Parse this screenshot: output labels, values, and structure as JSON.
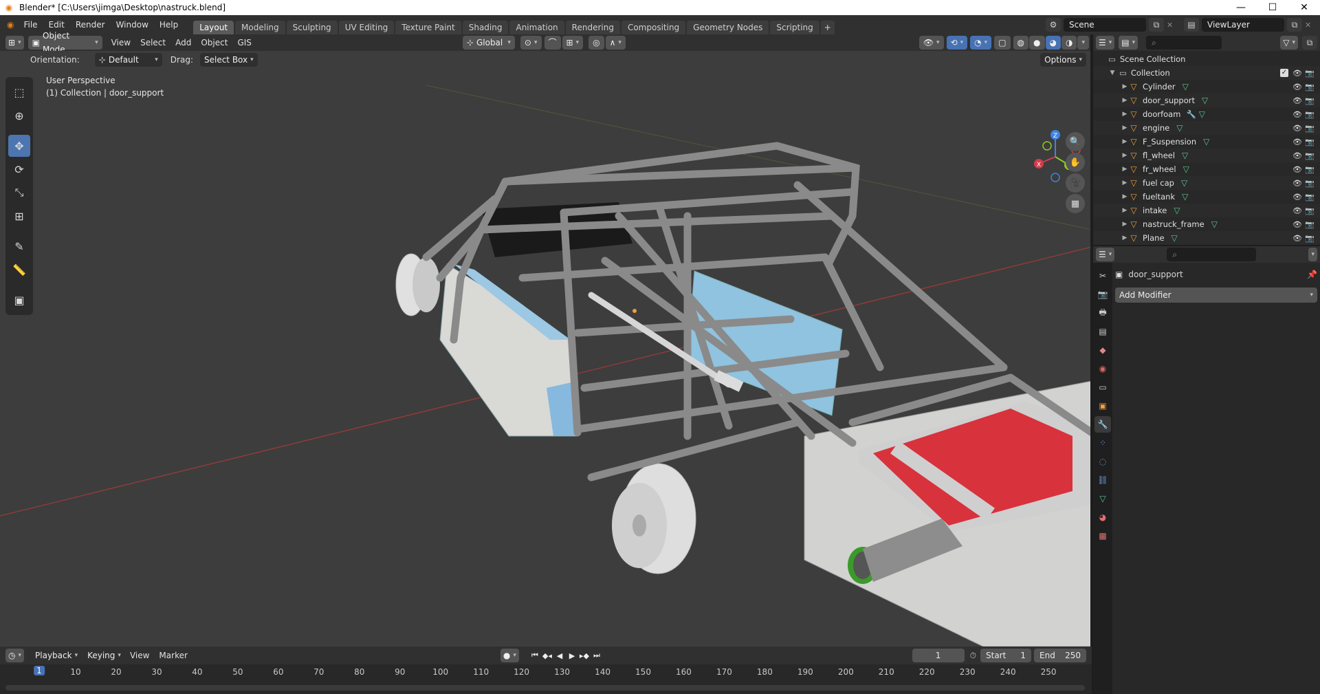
{
  "titlebar": {
    "title": "Blender* [C:\\Users\\jimga\\Desktop\\nastruck.blend]",
    "minimize": "—",
    "maximize": "☐",
    "close": "✕"
  },
  "menu": {
    "items": [
      "File",
      "Edit",
      "Render",
      "Window",
      "Help"
    ]
  },
  "workspaces": {
    "tabs": [
      "Layout",
      "Modeling",
      "Sculpting",
      "UV Editing",
      "Texture Paint",
      "Shading",
      "Animation",
      "Rendering",
      "Compositing",
      "Geometry Nodes",
      "Scripting"
    ],
    "active": "Layout",
    "plus": "+"
  },
  "scene": {
    "name": "Scene"
  },
  "viewlayer": {
    "name": "ViewLayer"
  },
  "viewport_header": {
    "mode": "Object Mode",
    "menus": [
      "View",
      "Select",
      "Add",
      "Object",
      "GIS"
    ],
    "transform_orientation": "Global"
  },
  "tool_settings": {
    "orientation_label": "Orientation:",
    "orientation_value": "Default",
    "drag_label": "Drag:",
    "drag_value": "Select Box",
    "options": "Options"
  },
  "viewport": {
    "perspective": "User Perspective",
    "collection_info": "(1) Collection | door_support",
    "gizmo": {
      "x": "X",
      "y": "Y",
      "z": "Z"
    }
  },
  "outliner": {
    "root": "Scene Collection",
    "collection": "Collection",
    "objects": [
      {
        "name": "Cylinder",
        "modifier": false
      },
      {
        "name": "door_support",
        "modifier": false
      },
      {
        "name": "doorfoam",
        "modifier": true
      },
      {
        "name": "engine",
        "modifier": false
      },
      {
        "name": "F_Suspension",
        "modifier": false
      },
      {
        "name": "fl_wheel",
        "modifier": false
      },
      {
        "name": "fr_wheel",
        "modifier": false
      },
      {
        "name": "fuel cap",
        "modifier": false
      },
      {
        "name": "fueltank",
        "modifier": false
      },
      {
        "name": "intake",
        "modifier": false
      },
      {
        "name": "nastruck_frame",
        "modifier": false
      },
      {
        "name": "Plane",
        "modifier": false
      }
    ]
  },
  "properties": {
    "object_name": "door_support",
    "add_modifier": "Add Modifier"
  },
  "timeline": {
    "menus": [
      "Playback",
      "Keying",
      "View",
      "Marker"
    ],
    "current_frame": "1",
    "start_label": "Start",
    "start": "1",
    "end_label": "End",
    "end": "250",
    "ticks": [
      "1",
      "10",
      "20",
      "30",
      "40",
      "50",
      "60",
      "70",
      "80",
      "90",
      "100",
      "110",
      "120",
      "130",
      "140",
      "150",
      "160",
      "170",
      "180",
      "190",
      "200",
      "210",
      "220",
      "230",
      "240",
      "250"
    ]
  },
  "colors": {
    "accent": "#4772b3",
    "object_icon": "#f29e3a",
    "mesh_icon": "#5ec58e",
    "x_axis": "#d33c4a",
    "y_axis": "#8ccd26",
    "z_axis": "#3f84e0"
  }
}
